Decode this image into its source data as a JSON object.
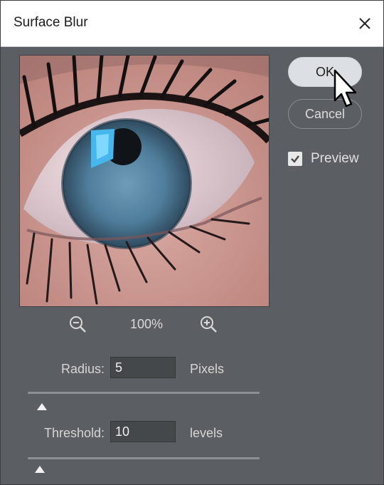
{
  "dialog": {
    "title": "Surface Blur",
    "close_icon": "close-icon"
  },
  "preview": {
    "zoom_level": "100%",
    "zoom_out_icon": "zoom-out-icon",
    "zoom_in_icon": "zoom-in-icon"
  },
  "buttons": {
    "ok_label": "OK",
    "cancel_label": "Cancel"
  },
  "preview_checkbox": {
    "label": "Preview",
    "checked": true
  },
  "radius": {
    "label": "Radius:",
    "value": "5",
    "unit": "Pixels",
    "slider_fraction": 0.03
  },
  "threshold": {
    "label": "Threshold:",
    "value": "10",
    "unit": "levels",
    "slider_fraction": 0.02
  },
  "colors": {
    "dialog_bg": "#5b5e62",
    "titlebar_bg": "#ffffff",
    "ok_button_bg": "#dcdfe3",
    "iris": "#4f7e9c"
  }
}
